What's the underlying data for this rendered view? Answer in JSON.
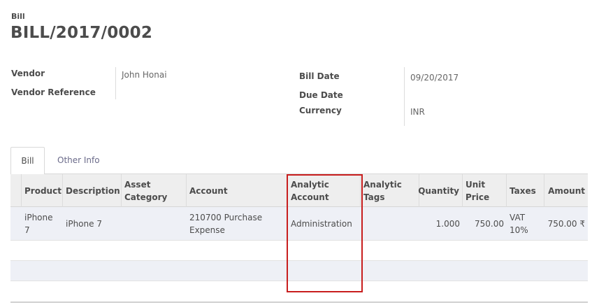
{
  "header": {
    "doc_type": "Bill",
    "title": "BILL/2017/0002"
  },
  "form": {
    "vendor_label": "Vendor",
    "vendor_value": "John Honai",
    "vendor_ref_label": "Vendor Reference",
    "vendor_ref_value": "",
    "bill_date_label": "Bill Date",
    "bill_date_value": "09/20/2017",
    "due_date_label": "Due Date",
    "due_date_value": "",
    "currency_label": "Currency",
    "currency_value": "INR"
  },
  "tabs": [
    {
      "label": "Bill",
      "active": true
    },
    {
      "label": "Other Info",
      "active": false
    }
  ],
  "table": {
    "columns": [
      "Product",
      "Description",
      "Asset Category",
      "Account",
      "Analytic Account",
      "Analytic Tags",
      "Quantity",
      "Unit Price",
      "Taxes",
      "Amount"
    ],
    "rows": [
      {
        "product": "iPhone 7",
        "description": "iPhone 7",
        "asset_category": "",
        "account": "210700 Purchase Expense",
        "analytic_account": "Administration",
        "analytic_tags": "",
        "quantity": "1.000",
        "unit_price": "750.00",
        "taxes": "VAT 10%",
        "amount": "750.00 ₹"
      }
    ]
  },
  "colors": {
    "highlight": "#c81e1e",
    "header_bg": "#eeeeee",
    "alt_row_bg": "#eef0f6"
  }
}
